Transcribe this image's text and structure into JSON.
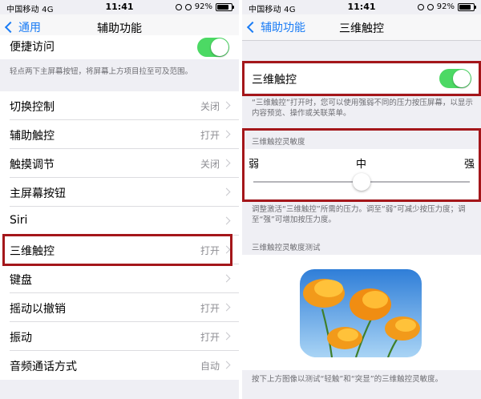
{
  "status_bar": {
    "carrier": "中国移动  4G",
    "time": "11:41",
    "battery": "92%"
  },
  "left": {
    "back_label": "通用",
    "title": "辅助功能",
    "reach_label": "便捷访问",
    "reach_footer": "轻点两下主屏幕按钮，将屏幕上方项目拉至可及范围。",
    "items": [
      {
        "label": "切换控制",
        "value": "关闭"
      },
      {
        "label": "辅助触控",
        "value": "打开"
      },
      {
        "label": "触摸调节",
        "value": "关闭"
      },
      {
        "label": "主屏幕按钮",
        "value": ""
      },
      {
        "label": "Siri",
        "value": ""
      },
      {
        "label": "三维触控",
        "value": "打开"
      },
      {
        "label": "键盘",
        "value": ""
      },
      {
        "label": "摇动以撤销",
        "value": "打开"
      },
      {
        "label": "振动",
        "value": "打开"
      },
      {
        "label": "音频通话方式",
        "value": "自动"
      }
    ]
  },
  "right": {
    "back_label": "辅助功能",
    "title": "三维触控",
    "toggle_label": "三维触控",
    "toggle_on": true,
    "toggle_footer": "“三维触控”打开时，您可以使用强弱不同的压力按压屏幕，以显示内容预览、操作或关联菜单。",
    "sensitivity_header": "三维触控灵敏度",
    "slider_labels": {
      "low": "弱",
      "mid": "中",
      "high": "强"
    },
    "slider_value": 0.5,
    "sensitivity_footer": "调整激活“三维触控”所需的压力。调至“弱”可减少按压力度；调至“强”可增加按压力度。",
    "test_header": "三维触控灵敏度测试",
    "test_footer": "按下上方图像以测试“轻触”和“突显”的三维触控灵敏度。"
  },
  "colors": {
    "accent": "#1a7cf5",
    "toggle_on": "#4cd964",
    "highlight": "#a4161a"
  }
}
